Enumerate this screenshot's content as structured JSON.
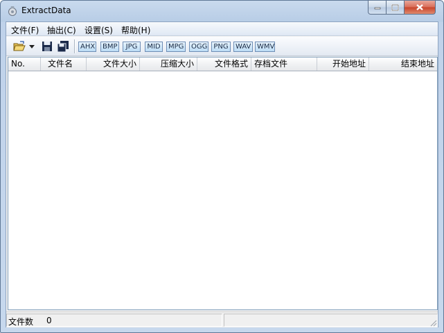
{
  "window": {
    "title": "ExtractData"
  },
  "menu": [
    {
      "label": "文件(F)"
    },
    {
      "label": "抽出(C)"
    },
    {
      "label": "设置(S)"
    },
    {
      "label": "帮助(H)"
    }
  ],
  "toolbar": {
    "filters": [
      "AHX",
      "BMP",
      "JPG",
      "MID",
      "MPG",
      "OGG",
      "PNG",
      "WAV",
      "WMV"
    ]
  },
  "table": {
    "columns": [
      "No.",
      "文件名",
      "文件大小",
      "压缩大小",
      "文件格式",
      "存档文件",
      "开始地址",
      "结束地址"
    ],
    "rows": []
  },
  "status": {
    "file_count_label": "文件数",
    "file_count": "0"
  },
  "colors": {
    "titlebar": "#c9daee",
    "close": "#c7432a",
    "filter_fill": "#bcdcf5"
  }
}
